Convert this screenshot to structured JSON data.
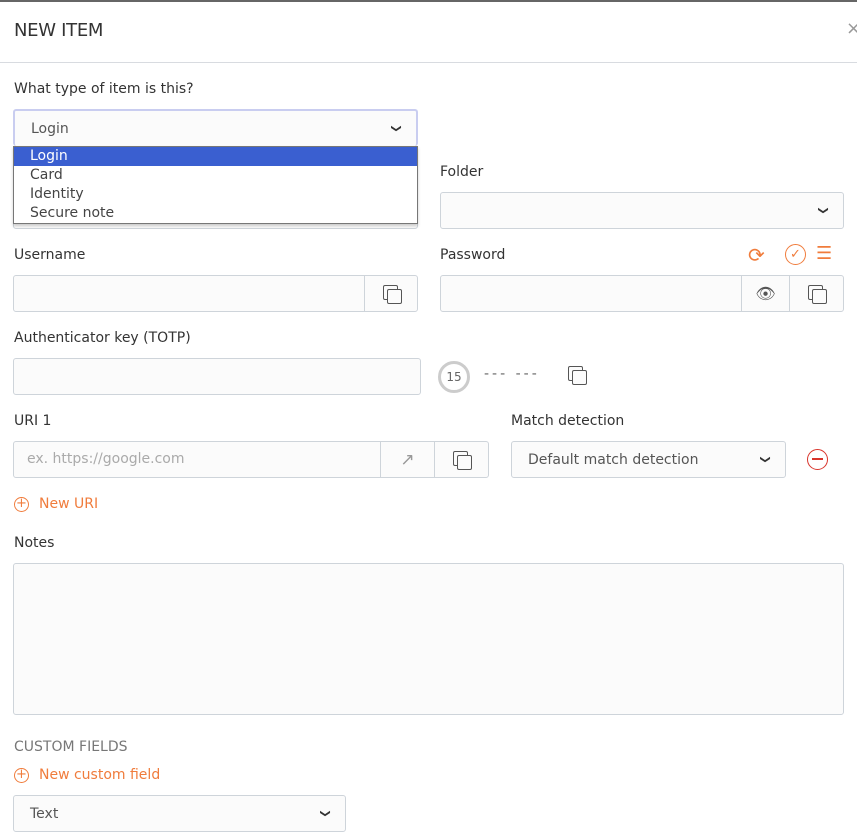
{
  "modal": {
    "title": "NEW ITEM",
    "close": "×"
  },
  "type": {
    "label": "What type of item is this?",
    "value": "Login",
    "options": [
      "Login",
      "Card",
      "Identity",
      "Secure note"
    ],
    "selected": "Login"
  },
  "folder": {
    "label": "Folder",
    "value": ""
  },
  "username": {
    "label": "Username",
    "value": ""
  },
  "password": {
    "label": "Password",
    "value": ""
  },
  "totp": {
    "label": "Authenticator key (TOTP)",
    "value": "",
    "countdown": "15",
    "code": "--- ---"
  },
  "uri": {
    "label": "URI 1",
    "placeholder": "ex. https://google.com",
    "match_label": "Match detection",
    "match_value": "Default match detection",
    "new_uri": "New URI"
  },
  "notes": {
    "label": "Notes",
    "value": ""
  },
  "custom": {
    "heading": "CUSTOM FIELDS",
    "new_field": "New custom field",
    "type_value": "Text"
  },
  "colors": {
    "accent": "#f07c3c",
    "danger": "#d9342b",
    "selected_option": "#3a5fd0"
  }
}
